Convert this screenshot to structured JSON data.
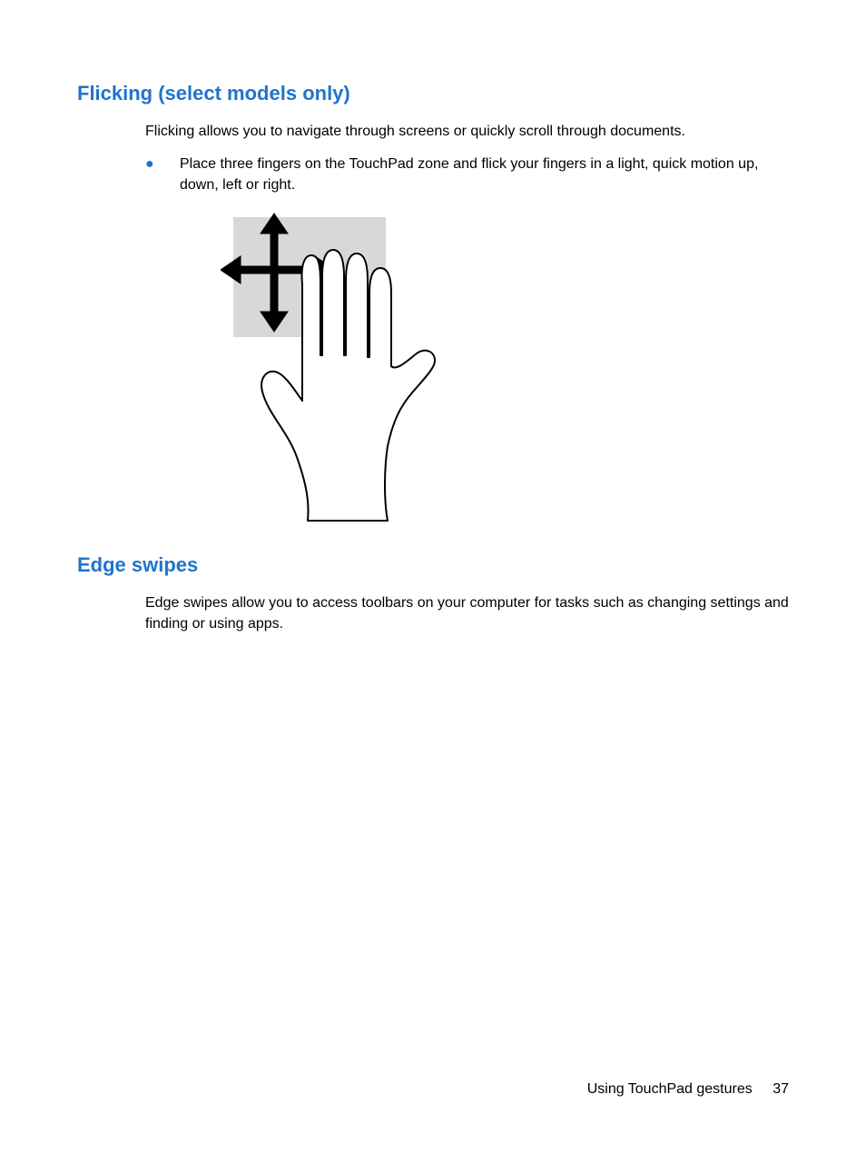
{
  "sections": [
    {
      "heading": "Flicking (select models only)",
      "intro": "Flicking allows you to navigate through screens or quickly scroll through documents.",
      "bullet": "Place three fingers on the TouchPad zone and flick your fingers in a light, quick motion up, down, left or right."
    },
    {
      "heading": "Edge swipes",
      "intro": "Edge swipes allow you to access toolbars on your computer for tasks such as changing settings and finding or using apps."
    }
  ],
  "footer": {
    "title": "Using TouchPad gestures",
    "page": "37"
  }
}
